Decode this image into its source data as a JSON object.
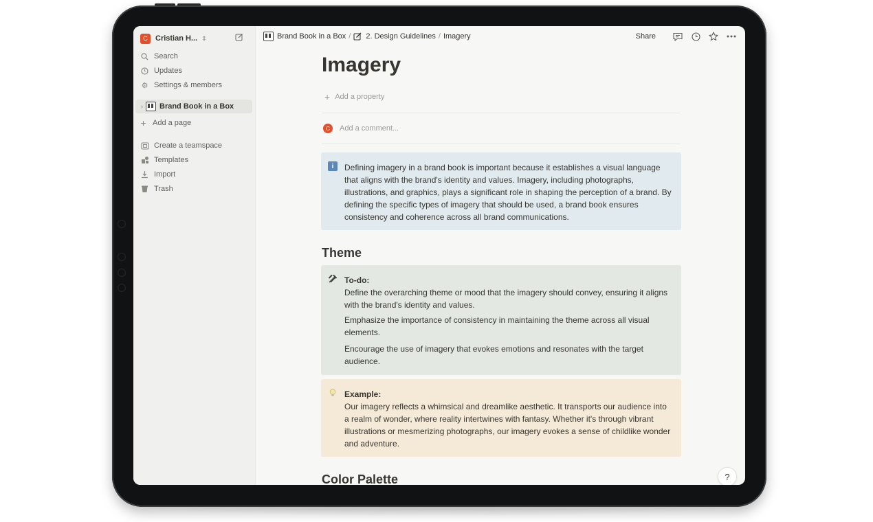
{
  "workspace": {
    "avatar": "C",
    "name": "Cristian H...",
    "accent": "#e1502a"
  },
  "sidebar": {
    "items": [
      {
        "label": "Search",
        "icon": "search-icon"
      },
      {
        "label": "Updates",
        "icon": "clock-icon"
      },
      {
        "label": "Settings & members",
        "icon": "gear-icon"
      }
    ],
    "page": {
      "label": "Brand Book in a Box",
      "icon": "book-icon"
    },
    "add_page": "Add a page",
    "footer": [
      {
        "label": "Create a teamspace",
        "icon": "teamspace-icon"
      },
      {
        "label": "Templates",
        "icon": "templates-icon"
      },
      {
        "label": "Import",
        "icon": "import-icon"
      },
      {
        "label": "Trash",
        "icon": "trash-icon"
      }
    ]
  },
  "breadcrumb": {
    "items": [
      "Brand Book in a Box",
      "2. Design Guidelines",
      "Imagery"
    ],
    "separator": "/"
  },
  "topbar": {
    "share": "Share"
  },
  "page": {
    "title": "Imagery",
    "add_property": "Add a property",
    "comment_avatar": "C",
    "comment_placeholder": "Add a comment...",
    "intro": "Defining imagery in a brand book is important because it establishes a visual language that aligns with the brand's identity and values. Imagery, including photographs, illustrations, and graphics, plays a significant role in shaping the perception of a brand. By defining the specific types of imagery that should be used, a brand book ensures consistency and coherence across all brand communications.",
    "theme_heading": "Theme",
    "todo": {
      "label": "To-do:",
      "lines": [
        "Define the overarching theme or mood that the imagery should convey, ensuring it aligns with the brand's identity and values.",
        "Emphasize the importance of consistency in maintaining the theme across all visual elements.",
        "Encourage the use of imagery that evokes emotions and resonates with the target audience."
      ]
    },
    "example": {
      "label": "Example:",
      "text": "Our imagery reflects a whimsical and dreamlike aesthetic. It transports our audience into a realm of wonder, where reality intertwines with fantasy. Whether it's through vibrant illustrations or mesmerizing photographs, our imagery evokes a sense of childlike wonder and adventure."
    },
    "color_heading": "Color Palette"
  },
  "help": "?"
}
